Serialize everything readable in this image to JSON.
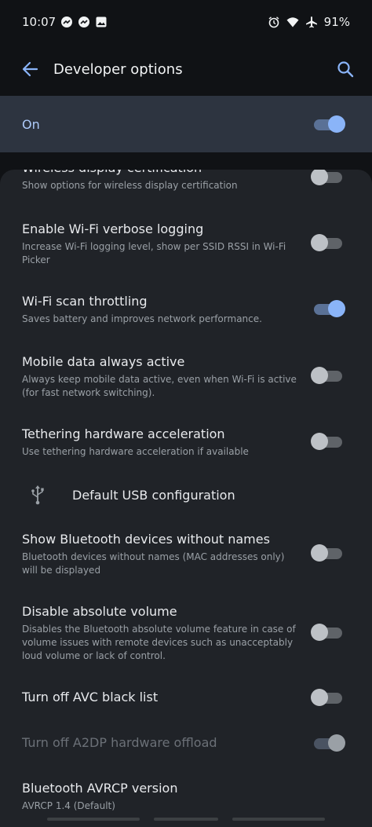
{
  "status_bar": {
    "time": "10:07",
    "left_icons": [
      "messenger-icon",
      "messenger-icon",
      "gallery-icon"
    ],
    "right_icons": [
      "alarm-icon",
      "wifi-icon",
      "airplane-icon"
    ],
    "battery": "91%"
  },
  "app_bar": {
    "title": "Developer options"
  },
  "master": {
    "label": "On",
    "state": true
  },
  "settings": [
    {
      "title": "Wireless display certification",
      "subtitle": "Show options for wireless display certification",
      "toggle": false
    },
    {
      "title": "Enable Wi-Fi verbose logging",
      "subtitle": "Increase Wi-Fi logging level, show per SSID RSSI in Wi-Fi Picker",
      "toggle": false
    },
    {
      "title": "Wi-Fi scan throttling",
      "subtitle": "Saves battery and improves network performance.",
      "toggle": true
    },
    {
      "title": "Mobile data always active",
      "subtitle": "Always keep mobile data active, even when Wi-Fi is active (for fast network switching).",
      "toggle": false
    },
    {
      "title": "Tethering hardware acceleration",
      "subtitle": "Use tethering hardware acceleration if available",
      "toggle": false
    },
    {
      "title": "Default USB configuration",
      "icon": "usb-icon"
    },
    {
      "title": "Show Bluetooth devices without names",
      "subtitle": "Bluetooth devices without names (MAC addresses only) will be displayed",
      "toggle": false
    },
    {
      "title": "Disable absolute volume",
      "subtitle": "Disables the Bluetooth absolute volume feature in case of volume issues with remote devices such as unacceptably loud volume or lack of control.",
      "toggle": false
    },
    {
      "title": "Turn off AVC black list",
      "toggle": false
    },
    {
      "title": "Turn off A2DP hardware offload",
      "toggle": true,
      "disabled": true
    },
    {
      "title": "Bluetooth AVRCP version",
      "subtitle": "AVRCP 1.4 (Default)"
    }
  ],
  "colors": {
    "accent": "#8ab4f8",
    "background": "#101215",
    "panel": "#202328",
    "master_bar": "#2d3440"
  }
}
